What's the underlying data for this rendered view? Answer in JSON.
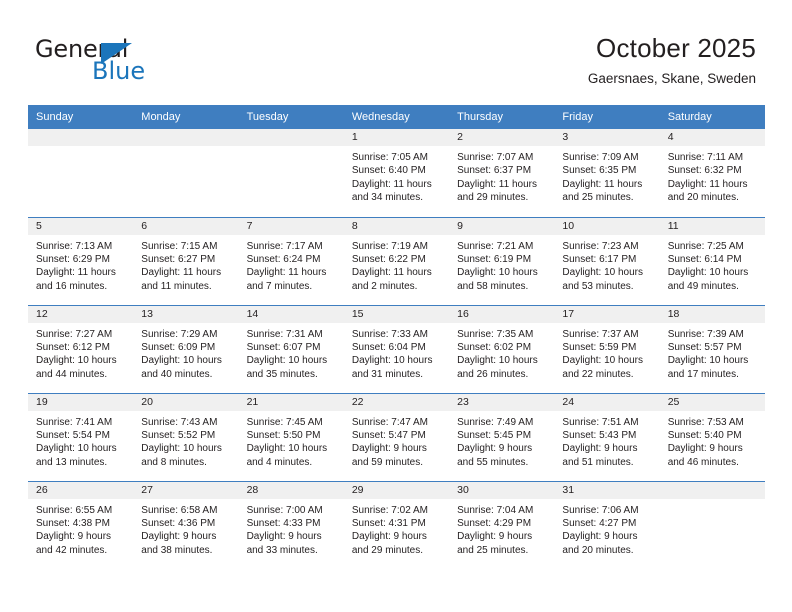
{
  "logo": {
    "word_one": "General",
    "word_two": "Blue",
    "accent_color": "#1b75bb",
    "triangle_icon": "blue-triangle-icon"
  },
  "header": {
    "title": "October 2025",
    "location": "Gaersnaes, Skane, Sweden"
  },
  "theme": {
    "header_row_bg": "#3f7ec0",
    "daynum_strip_bg": "#f0f0f0",
    "text_color": "#231f20"
  },
  "weekday_headers": [
    "Sunday",
    "Monday",
    "Tuesday",
    "Wednesday",
    "Thursday",
    "Friday",
    "Saturday"
  ],
  "weeks": [
    [
      {
        "day": "",
        "empty": true
      },
      {
        "day": "",
        "empty": true
      },
      {
        "day": "",
        "empty": true
      },
      {
        "day": "1",
        "sunrise": "Sunrise: 7:05 AM",
        "sunset": "Sunset: 6:40 PM",
        "daylight_1": "Daylight: 11 hours",
        "daylight_2": "and 34 minutes."
      },
      {
        "day": "2",
        "sunrise": "Sunrise: 7:07 AM",
        "sunset": "Sunset: 6:37 PM",
        "daylight_1": "Daylight: 11 hours",
        "daylight_2": "and 29 minutes."
      },
      {
        "day": "3",
        "sunrise": "Sunrise: 7:09 AM",
        "sunset": "Sunset: 6:35 PM",
        "daylight_1": "Daylight: 11 hours",
        "daylight_2": "and 25 minutes."
      },
      {
        "day": "4",
        "sunrise": "Sunrise: 7:11 AM",
        "sunset": "Sunset: 6:32 PM",
        "daylight_1": "Daylight: 11 hours",
        "daylight_2": "and 20 minutes."
      }
    ],
    [
      {
        "day": "5",
        "sunrise": "Sunrise: 7:13 AM",
        "sunset": "Sunset: 6:29 PM",
        "daylight_1": "Daylight: 11 hours",
        "daylight_2": "and 16 minutes."
      },
      {
        "day": "6",
        "sunrise": "Sunrise: 7:15 AM",
        "sunset": "Sunset: 6:27 PM",
        "daylight_1": "Daylight: 11 hours",
        "daylight_2": "and 11 minutes."
      },
      {
        "day": "7",
        "sunrise": "Sunrise: 7:17 AM",
        "sunset": "Sunset: 6:24 PM",
        "daylight_1": "Daylight: 11 hours",
        "daylight_2": "and 7 minutes."
      },
      {
        "day": "8",
        "sunrise": "Sunrise: 7:19 AM",
        "sunset": "Sunset: 6:22 PM",
        "daylight_1": "Daylight: 11 hours",
        "daylight_2": "and 2 minutes."
      },
      {
        "day": "9",
        "sunrise": "Sunrise: 7:21 AM",
        "sunset": "Sunset: 6:19 PM",
        "daylight_1": "Daylight: 10 hours",
        "daylight_2": "and 58 minutes."
      },
      {
        "day": "10",
        "sunrise": "Sunrise: 7:23 AM",
        "sunset": "Sunset: 6:17 PM",
        "daylight_1": "Daylight: 10 hours",
        "daylight_2": "and 53 minutes."
      },
      {
        "day": "11",
        "sunrise": "Sunrise: 7:25 AM",
        "sunset": "Sunset: 6:14 PM",
        "daylight_1": "Daylight: 10 hours",
        "daylight_2": "and 49 minutes."
      }
    ],
    [
      {
        "day": "12",
        "sunrise": "Sunrise: 7:27 AM",
        "sunset": "Sunset: 6:12 PM",
        "daylight_1": "Daylight: 10 hours",
        "daylight_2": "and 44 minutes."
      },
      {
        "day": "13",
        "sunrise": "Sunrise: 7:29 AM",
        "sunset": "Sunset: 6:09 PM",
        "daylight_1": "Daylight: 10 hours",
        "daylight_2": "and 40 minutes."
      },
      {
        "day": "14",
        "sunrise": "Sunrise: 7:31 AM",
        "sunset": "Sunset: 6:07 PM",
        "daylight_1": "Daylight: 10 hours",
        "daylight_2": "and 35 minutes."
      },
      {
        "day": "15",
        "sunrise": "Sunrise: 7:33 AM",
        "sunset": "Sunset: 6:04 PM",
        "daylight_1": "Daylight: 10 hours",
        "daylight_2": "and 31 minutes."
      },
      {
        "day": "16",
        "sunrise": "Sunrise: 7:35 AM",
        "sunset": "Sunset: 6:02 PM",
        "daylight_1": "Daylight: 10 hours",
        "daylight_2": "and 26 minutes."
      },
      {
        "day": "17",
        "sunrise": "Sunrise: 7:37 AM",
        "sunset": "Sunset: 5:59 PM",
        "daylight_1": "Daylight: 10 hours",
        "daylight_2": "and 22 minutes."
      },
      {
        "day": "18",
        "sunrise": "Sunrise: 7:39 AM",
        "sunset": "Sunset: 5:57 PM",
        "daylight_1": "Daylight: 10 hours",
        "daylight_2": "and 17 minutes."
      }
    ],
    [
      {
        "day": "19",
        "sunrise": "Sunrise: 7:41 AM",
        "sunset": "Sunset: 5:54 PM",
        "daylight_1": "Daylight: 10 hours",
        "daylight_2": "and 13 minutes."
      },
      {
        "day": "20",
        "sunrise": "Sunrise: 7:43 AM",
        "sunset": "Sunset: 5:52 PM",
        "daylight_1": "Daylight: 10 hours",
        "daylight_2": "and 8 minutes."
      },
      {
        "day": "21",
        "sunrise": "Sunrise: 7:45 AM",
        "sunset": "Sunset: 5:50 PM",
        "daylight_1": "Daylight: 10 hours",
        "daylight_2": "and 4 minutes."
      },
      {
        "day": "22",
        "sunrise": "Sunrise: 7:47 AM",
        "sunset": "Sunset: 5:47 PM",
        "daylight_1": "Daylight: 9 hours",
        "daylight_2": "and 59 minutes."
      },
      {
        "day": "23",
        "sunrise": "Sunrise: 7:49 AM",
        "sunset": "Sunset: 5:45 PM",
        "daylight_1": "Daylight: 9 hours",
        "daylight_2": "and 55 minutes."
      },
      {
        "day": "24",
        "sunrise": "Sunrise: 7:51 AM",
        "sunset": "Sunset: 5:43 PM",
        "daylight_1": "Daylight: 9 hours",
        "daylight_2": "and 51 minutes."
      },
      {
        "day": "25",
        "sunrise": "Sunrise: 7:53 AM",
        "sunset": "Sunset: 5:40 PM",
        "daylight_1": "Daylight: 9 hours",
        "daylight_2": "and 46 minutes."
      }
    ],
    [
      {
        "day": "26",
        "sunrise": "Sunrise: 6:55 AM",
        "sunset": "Sunset: 4:38 PM",
        "daylight_1": "Daylight: 9 hours",
        "daylight_2": "and 42 minutes."
      },
      {
        "day": "27",
        "sunrise": "Sunrise: 6:58 AM",
        "sunset": "Sunset: 4:36 PM",
        "daylight_1": "Daylight: 9 hours",
        "daylight_2": "and 38 minutes."
      },
      {
        "day": "28",
        "sunrise": "Sunrise: 7:00 AM",
        "sunset": "Sunset: 4:33 PM",
        "daylight_1": "Daylight: 9 hours",
        "daylight_2": "and 33 minutes."
      },
      {
        "day": "29",
        "sunrise": "Sunrise: 7:02 AM",
        "sunset": "Sunset: 4:31 PM",
        "daylight_1": "Daylight: 9 hours",
        "daylight_2": "and 29 minutes."
      },
      {
        "day": "30",
        "sunrise": "Sunrise: 7:04 AM",
        "sunset": "Sunset: 4:29 PM",
        "daylight_1": "Daylight: 9 hours",
        "daylight_2": "and 25 minutes."
      },
      {
        "day": "31",
        "sunrise": "Sunrise: 7:06 AM",
        "sunset": "Sunset: 4:27 PM",
        "daylight_1": "Daylight: 9 hours",
        "daylight_2": "and 20 minutes."
      },
      {
        "day": "",
        "empty": true
      }
    ]
  ]
}
